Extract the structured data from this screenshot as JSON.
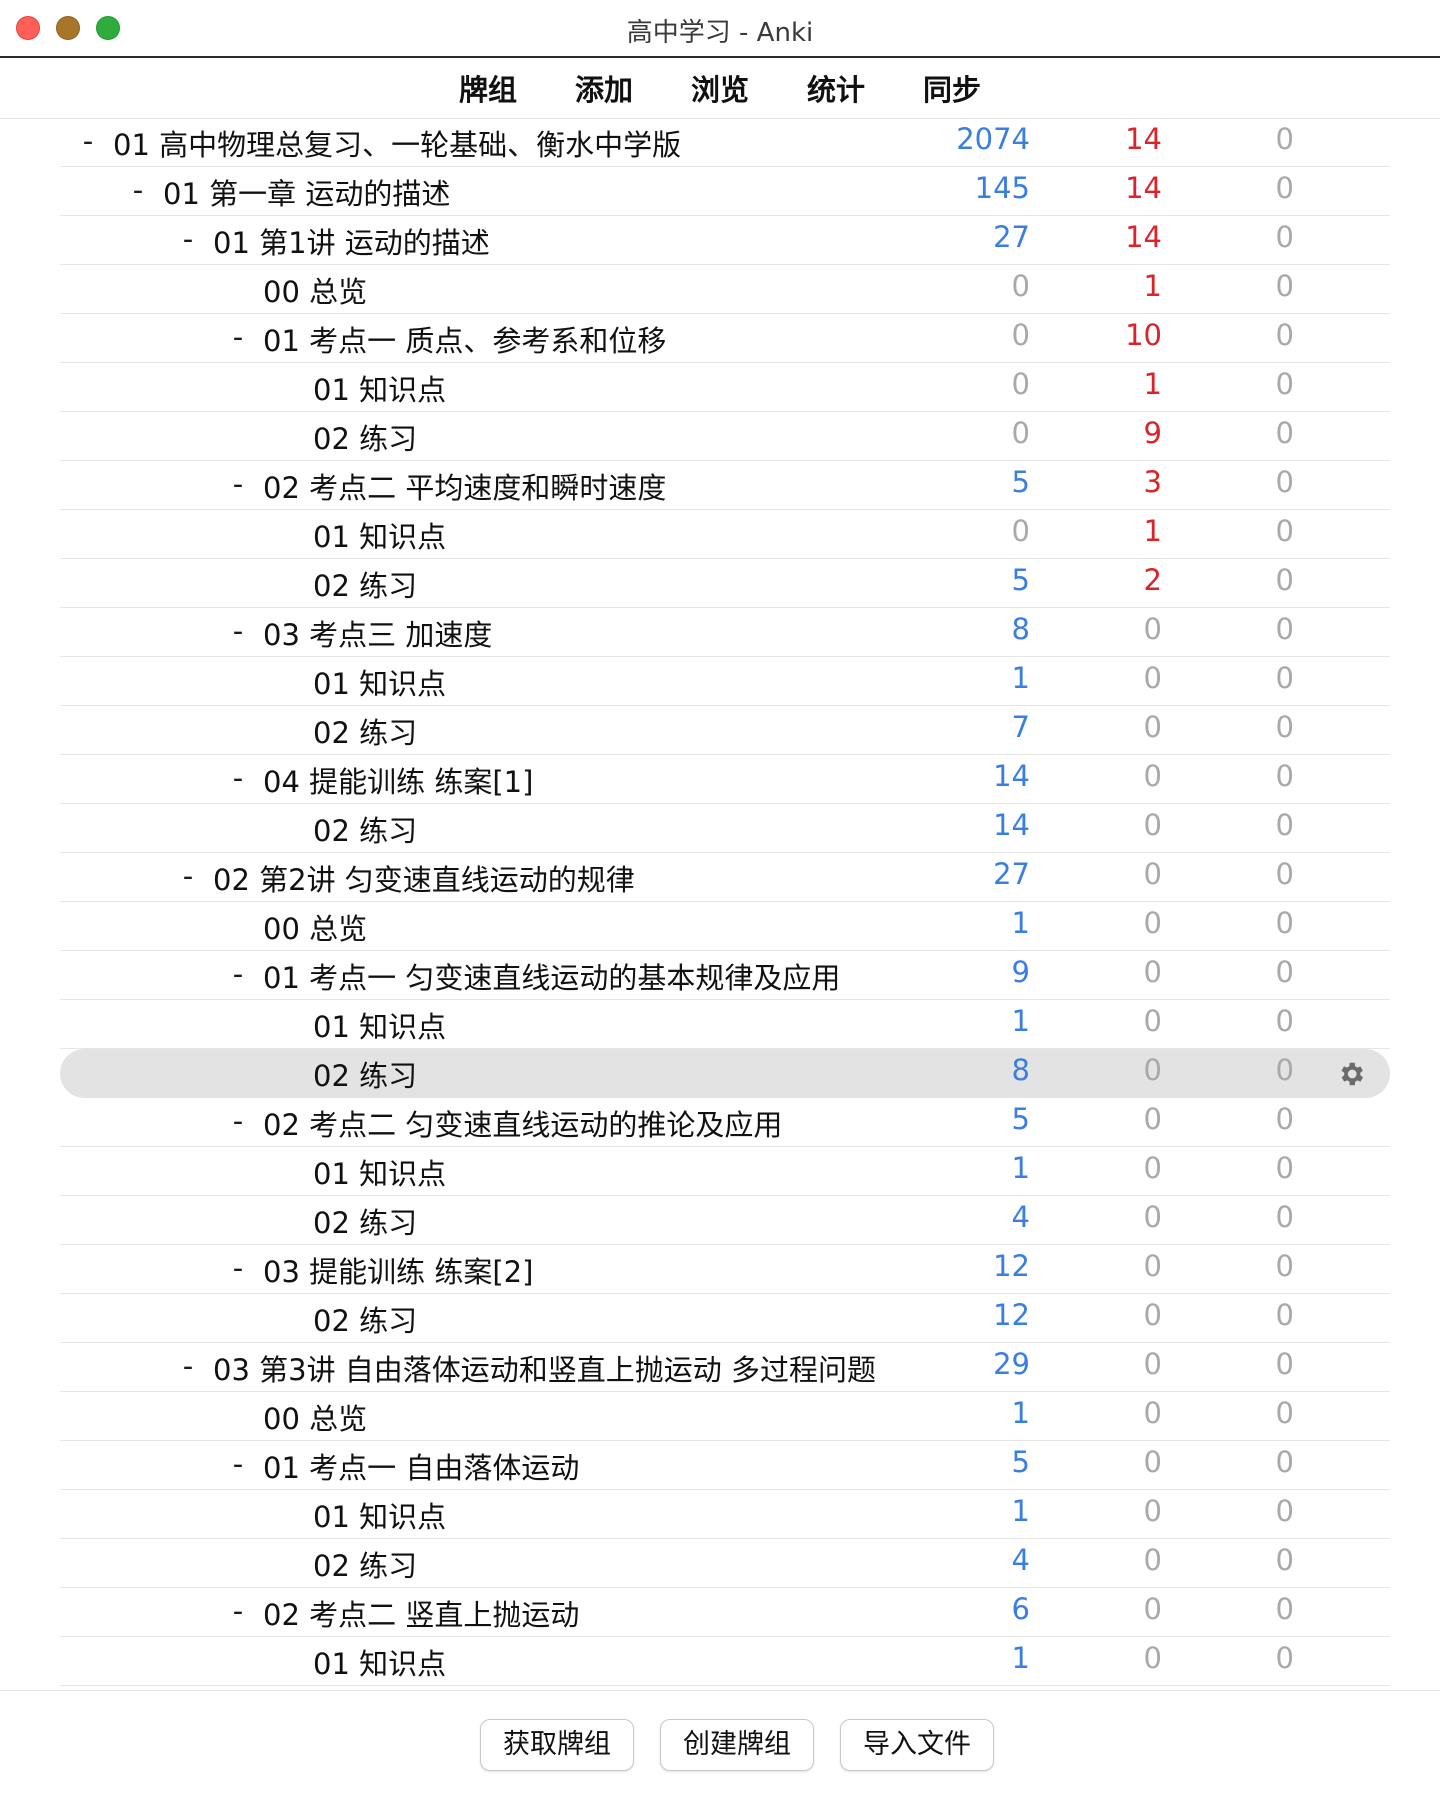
{
  "window": {
    "title": "高中学习 - Anki"
  },
  "colors": {
    "due": "#3a7ee0",
    "learn": "#d8242a",
    "zero": "#a9a9a9"
  },
  "toolbar": {
    "tabs": [
      {
        "label": "牌组"
      },
      {
        "label": "添加"
      },
      {
        "label": "浏览"
      },
      {
        "label": "统计"
      },
      {
        "label": "同步"
      }
    ]
  },
  "decks": [
    {
      "level": 0,
      "collapse": "-",
      "name": "01 高中物理总复习、一轮基础、衡水中学版",
      "due": "2074",
      "learn": "14",
      "new": "0"
    },
    {
      "level": 1,
      "collapse": "-",
      "name": "01 第一章 运动的描述",
      "due": "145",
      "learn": "14",
      "new": "0"
    },
    {
      "level": 2,
      "collapse": "-",
      "name": "01 第1讲 运动的描述",
      "due": "27",
      "learn": "14",
      "new": "0"
    },
    {
      "level": 3,
      "collapse": "",
      "name": "00 总览",
      "due": "0",
      "learn": "1",
      "new": "0"
    },
    {
      "level": 3,
      "collapse": "-",
      "name": "01 考点一 质点、参考系和位移",
      "due": "0",
      "learn": "10",
      "new": "0"
    },
    {
      "level": 4,
      "collapse": "",
      "name": "01 知识点",
      "due": "0",
      "learn": "1",
      "new": "0"
    },
    {
      "level": 4,
      "collapse": "",
      "name": "02 练习",
      "due": "0",
      "learn": "9",
      "new": "0"
    },
    {
      "level": 3,
      "collapse": "-",
      "name": "02 考点二 平均速度和瞬时速度",
      "due": "5",
      "learn": "3",
      "new": "0"
    },
    {
      "level": 4,
      "collapse": "",
      "name": "01 知识点",
      "due": "0",
      "learn": "1",
      "new": "0"
    },
    {
      "level": 4,
      "collapse": "",
      "name": "02 练习",
      "due": "5",
      "learn": "2",
      "new": "0"
    },
    {
      "level": 3,
      "collapse": "-",
      "name": "03 考点三 加速度",
      "due": "8",
      "learn": "0",
      "new": "0"
    },
    {
      "level": 4,
      "collapse": "",
      "name": "01 知识点",
      "due": "1",
      "learn": "0",
      "new": "0"
    },
    {
      "level": 4,
      "collapse": "",
      "name": "02 练习",
      "due": "7",
      "learn": "0",
      "new": "0"
    },
    {
      "level": 3,
      "collapse": "-",
      "name": "04 提能训练 练案[1]",
      "due": "14",
      "learn": "0",
      "new": "0"
    },
    {
      "level": 4,
      "collapse": "",
      "name": "02 练习",
      "due": "14",
      "learn": "0",
      "new": "0"
    },
    {
      "level": 2,
      "collapse": "-",
      "name": "02 第2讲 匀变速直线运动的规律",
      "due": "27",
      "learn": "0",
      "new": "0"
    },
    {
      "level": 3,
      "collapse": "",
      "name": "00 总览",
      "due": "1",
      "learn": "0",
      "new": "0"
    },
    {
      "level": 3,
      "collapse": "-",
      "name": "01 考点一 匀变速直线运动的基本规律及应用",
      "due": "9",
      "learn": "0",
      "new": "0"
    },
    {
      "level": 4,
      "collapse": "",
      "name": "01 知识点",
      "due": "1",
      "learn": "0",
      "new": "0"
    },
    {
      "level": 4,
      "collapse": "",
      "name": "02 练习",
      "due": "8",
      "learn": "0",
      "new": "0",
      "selected": true
    },
    {
      "level": 3,
      "collapse": "-",
      "name": "02 考点二 匀变速直线运动的推论及应用",
      "due": "5",
      "learn": "0",
      "new": "0"
    },
    {
      "level": 4,
      "collapse": "",
      "name": "01 知识点",
      "due": "1",
      "learn": "0",
      "new": "0"
    },
    {
      "level": 4,
      "collapse": "",
      "name": "02 练习",
      "due": "4",
      "learn": "0",
      "new": "0"
    },
    {
      "level": 3,
      "collapse": "-",
      "name": "03 提能训练 练案[2]",
      "due": "12",
      "learn": "0",
      "new": "0"
    },
    {
      "level": 4,
      "collapse": "",
      "name": "02 练习",
      "due": "12",
      "learn": "0",
      "new": "0"
    },
    {
      "level": 2,
      "collapse": "-",
      "name": "03 第3讲 自由落体运动和竖直上抛运动 多过程问题",
      "due": "29",
      "learn": "0",
      "new": "0"
    },
    {
      "level": 3,
      "collapse": "",
      "name": "00 总览",
      "due": "1",
      "learn": "0",
      "new": "0"
    },
    {
      "level": 3,
      "collapse": "-",
      "name": "01 考点一 自由落体运动",
      "due": "5",
      "learn": "0",
      "new": "0"
    },
    {
      "level": 4,
      "collapse": "",
      "name": "01 知识点",
      "due": "1",
      "learn": "0",
      "new": "0"
    },
    {
      "level": 4,
      "collapse": "",
      "name": "02 练习",
      "due": "4",
      "learn": "0",
      "new": "0"
    },
    {
      "level": 3,
      "collapse": "-",
      "name": "02 考点二 竖直上抛运动",
      "due": "6",
      "learn": "0",
      "new": "0"
    },
    {
      "level": 4,
      "collapse": "",
      "name": "01 知识点",
      "due": "1",
      "learn": "0",
      "new": "0"
    }
  ],
  "bottom": {
    "get_shared": "获取牌组",
    "create_deck": "创建牌组",
    "import_file": "导入文件"
  }
}
